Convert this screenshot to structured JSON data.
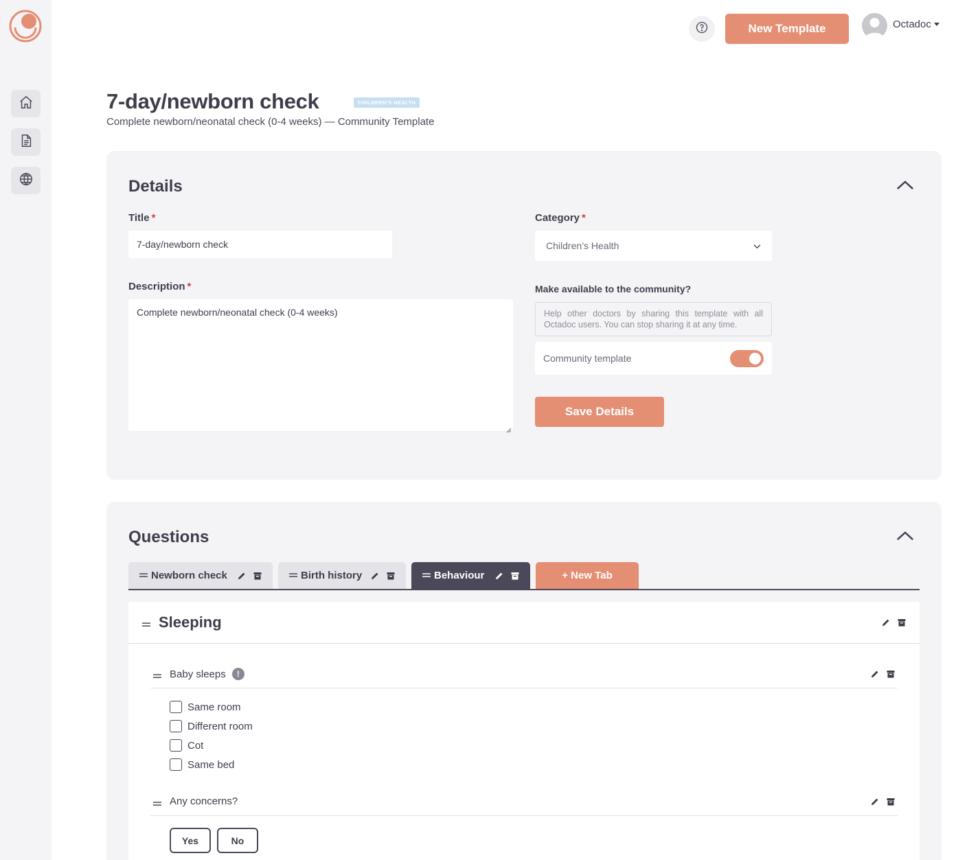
{
  "header": {
    "help_icon": "question-circle-icon",
    "new_template_label": "New Template",
    "user_name": "Octadoc"
  },
  "sidebar": {
    "items": [
      {
        "icon": "home-icon"
      },
      {
        "icon": "document-icon"
      },
      {
        "icon": "globe-icon"
      }
    ]
  },
  "page": {
    "title": "7-day/newborn check",
    "category_badge": "CHILDREN'S HEALTH",
    "subtitle": "Complete newborn/neonatal check (0-4 weeks) — Community Template"
  },
  "details": {
    "heading": "Details",
    "title_label": "Title",
    "title_value": "7-day/newborn check",
    "required_mark": "*",
    "category_label": "Category",
    "category_value": "Children’s Health",
    "description_label": "Description",
    "description_value": "Complete newborn/neonatal check (0-4 weeks)",
    "community_label": "Make available to the community?",
    "community_help": "Help other doctors by sharing this template with all Octadoc users. You can stop sharing it at any time.",
    "community_toggle_label": "Community template",
    "community_toggle_on": true,
    "save_label": "Save Details"
  },
  "questions": {
    "heading": "Questions",
    "tabs": [
      {
        "label": "Newborn check",
        "active": false
      },
      {
        "label": "Birth history",
        "active": false
      },
      {
        "label": "Behaviour",
        "active": true
      }
    ],
    "new_tab_label": "+ New Tab",
    "section": {
      "title": "Sleeping",
      "items": [
        {
          "label": "Baby sleeps",
          "info": "!",
          "options": [
            "Same room",
            "Different room",
            "Cot",
            "Same bed"
          ]
        },
        {
          "label": "Any concerns?",
          "buttons": [
            "Yes",
            "No"
          ]
        }
      ]
    }
  },
  "colors": {
    "accent": "#e48e74",
    "dark": "#4b4859",
    "badge": "#c6dff3",
    "panel": "#f4f4f7"
  }
}
